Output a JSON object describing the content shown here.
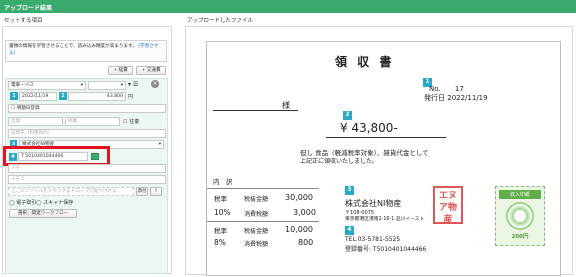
{
  "window": {
    "title": "アップロード結果"
  },
  "left_section_title": "セットする項目",
  "right_section_title": "アップロードしたファイル",
  "info": {
    "text": "書類の情報を学習させることで、読み込み精度が高まります。",
    "link": "[学習させる]"
  },
  "buttons": {
    "expense": "+ 経費",
    "transport": "+ 交通費",
    "attach_file": "添付",
    "help": "?",
    "select_workflow": "選択：関連ワークフロー"
  },
  "form": {
    "category": "電車・バス",
    "second_select": "",
    "date": "2022/11/19",
    "amount": "43,800",
    "amount_unit": "円",
    "checkbox_receipt_date": "増額日登録",
    "departure_ph": "出発",
    "arrival_ph": "到着",
    "roundtrip": "往復",
    "visit_ph": "訪問先（利用目的）",
    "company": "株式会社NI物産",
    "tax_label": "T",
    "tax_number": "5010401044466",
    "memo_ph": "メモ",
    "memo2_ph": "メモ２",
    "drop_text": "ここにファイルをドラッグ＆ドロップで貼り付ける",
    "radio_e": "電子取引",
    "radio_scan": "スキャナ保存"
  },
  "badges": {
    "b1": "1",
    "b2": "2",
    "b3": "3",
    "b4": "4"
  },
  "receipt": {
    "title": "領 収 書",
    "no_label": "No.",
    "no_value": "17",
    "issue_label": "発行日",
    "issue_date": "2022/11/19",
    "honorific": "様",
    "amount": "¥ 43,800-",
    "note1": "但し 食品（軽減税率対象）、雑貨代金として",
    "note2": "上記正に領収いたしました。",
    "breakdown_title": "内　訳",
    "rows": [
      {
        "rate": "税率",
        "label": "税抜金額",
        "value": "30,000"
      },
      {
        "rate": "10%",
        "label": "消費税額",
        "value": "3,000"
      },
      {
        "rate": "税率",
        "label": "税抜金額",
        "value": "10,000"
      },
      {
        "rate": "8%",
        "label": "消費税額",
        "value": "800"
      }
    ],
    "issuer_name": "株式会社NI物産",
    "issuer_zip": "〒108-0075",
    "issuer_address": "東京都港区港南2-16-1 品川イースト",
    "issuer_tel": "TEL.03-5781-5525",
    "issuer_reg": "登録番号: T5010401044466",
    "stamp_text": "エヌア物産",
    "revenue_stamp_label": "収入印紙",
    "revenue_stamp_value": "200円"
  },
  "colors": {
    "accent": "#3aaa6f",
    "badge": "#27a9c7",
    "highlight": "#e3141e"
  }
}
